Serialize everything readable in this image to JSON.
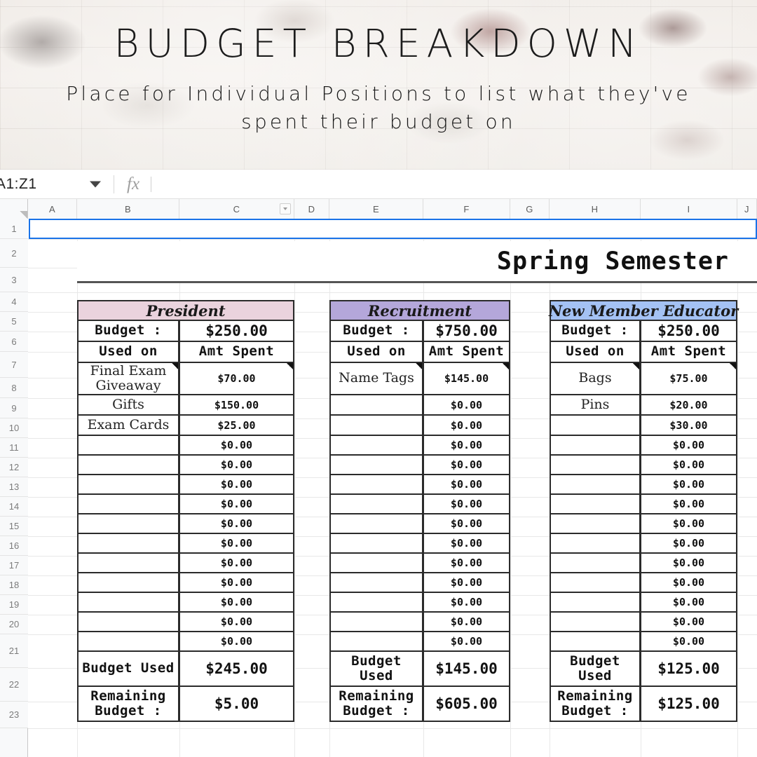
{
  "banner": {
    "title": "BUDGET BREAKDOWN",
    "subtitle": "Place for Individual Positions to list what they've spent their budget on"
  },
  "formula_bar": {
    "name_box_value": "A1:Z1",
    "name_box_dropdown_icon": "chevron-down-icon",
    "fx_icon": "fx-icon",
    "formula_value": "",
    "formula_placeholder": ""
  },
  "grid": {
    "column_headers": [
      "A",
      "B",
      "C",
      "D",
      "E",
      "F",
      "G",
      "H",
      "I",
      "J"
    ],
    "column_dropdown_on": "C",
    "row_headers": [
      "1",
      "2",
      "3",
      "4",
      "5",
      "6",
      "7",
      "8",
      "9",
      "10",
      "11",
      "12",
      "13",
      "14",
      "15",
      "16",
      "17",
      "18",
      "19",
      "20",
      "21",
      "22",
      "23"
    ],
    "selected_range": "A1:Z1"
  },
  "sheet": {
    "semester_title": "Spring Semester",
    "column_header_labels": {
      "used_on": "Used on",
      "amt_spent": "Amt Spent",
      "budget_label": "Budget :",
      "budget_used_label": "Budget Used",
      "remaining_label": "Remaining Budget :"
    },
    "tables": [
      {
        "name": "President",
        "header_color": "#ead3dd",
        "budget_label": "Budget :",
        "budget": "$250.00",
        "col_used_on": "Used on",
        "col_amt_spent": "Amt Spent",
        "items": [
          {
            "used_on": "Final Exam Giveaway",
            "amount": "$70.00",
            "note": true
          },
          {
            "used_on": "Gifts",
            "amount": "$150.00",
            "note": false
          },
          {
            "used_on": "Exam Cards",
            "amount": "$25.00",
            "note": false
          },
          {
            "used_on": "",
            "amount": "$0.00",
            "note": false
          },
          {
            "used_on": "",
            "amount": "$0.00",
            "note": false
          },
          {
            "used_on": "",
            "amount": "$0.00",
            "note": false
          },
          {
            "used_on": "",
            "amount": "$0.00",
            "note": false
          },
          {
            "used_on": "",
            "amount": "$0.00",
            "note": false
          },
          {
            "used_on": "",
            "amount": "$0.00",
            "note": false
          },
          {
            "used_on": "",
            "amount": "$0.00",
            "note": false
          },
          {
            "used_on": "",
            "amount": "$0.00",
            "note": false
          },
          {
            "used_on": "",
            "amount": "$0.00",
            "note": false
          },
          {
            "used_on": "",
            "amount": "$0.00",
            "note": false
          },
          {
            "used_on": "",
            "amount": "$0.00",
            "note": false
          }
        ],
        "budget_used_label": "Budget Used",
        "budget_used": "$245.00",
        "remaining_label": "Remaining Budget :",
        "remaining": "$5.00"
      },
      {
        "name": "Recruitment",
        "header_color": "#b4a7da",
        "budget_label": "Budget :",
        "budget": "$750.00",
        "col_used_on": "Used on",
        "col_amt_spent": "Amt Spent",
        "items": [
          {
            "used_on": "Name Tags",
            "amount": "$145.00",
            "note": true
          },
          {
            "used_on": "",
            "amount": "$0.00",
            "note": false
          },
          {
            "used_on": "",
            "amount": "$0.00",
            "note": false
          },
          {
            "used_on": "",
            "amount": "$0.00",
            "note": false
          },
          {
            "used_on": "",
            "amount": "$0.00",
            "note": false
          },
          {
            "used_on": "",
            "amount": "$0.00",
            "note": false
          },
          {
            "used_on": "",
            "amount": "$0.00",
            "note": false
          },
          {
            "used_on": "",
            "amount": "$0.00",
            "note": false
          },
          {
            "used_on": "",
            "amount": "$0.00",
            "note": false
          },
          {
            "used_on": "",
            "amount": "$0.00",
            "note": false
          },
          {
            "used_on": "",
            "amount": "$0.00",
            "note": false
          },
          {
            "used_on": "",
            "amount": "$0.00",
            "note": false
          },
          {
            "used_on": "",
            "amount": "$0.00",
            "note": false
          },
          {
            "used_on": "",
            "amount": "$0.00",
            "note": false
          }
        ],
        "budget_used_label": "Budget Used",
        "budget_used": "$145.00",
        "remaining_label": "Remaining Budget :",
        "remaining": "$605.00"
      },
      {
        "name": "New Member Educator",
        "header_color": "#a4c2f4",
        "budget_label": "Budget :",
        "budget": "$250.00",
        "col_used_on": "Used on",
        "col_amt_spent": "Amt Spent",
        "items": [
          {
            "used_on": "Bags",
            "amount": "$75.00",
            "note": true
          },
          {
            "used_on": "Pins",
            "amount": "$20.00",
            "note": false
          },
          {
            "used_on": "",
            "amount": "$30.00",
            "note": false
          },
          {
            "used_on": "",
            "amount": "$0.00",
            "note": false
          },
          {
            "used_on": "",
            "amount": "$0.00",
            "note": false
          },
          {
            "used_on": "",
            "amount": "$0.00",
            "note": false
          },
          {
            "used_on": "",
            "amount": "$0.00",
            "note": false
          },
          {
            "used_on": "",
            "amount": "$0.00",
            "note": false
          },
          {
            "used_on": "",
            "amount": "$0.00",
            "note": false
          },
          {
            "used_on": "",
            "amount": "$0.00",
            "note": false
          },
          {
            "used_on": "",
            "amount": "$0.00",
            "note": false
          },
          {
            "used_on": "",
            "amount": "$0.00",
            "note": false
          },
          {
            "used_on": "",
            "amount": "$0.00",
            "note": false
          },
          {
            "used_on": "",
            "amount": "$0.00",
            "note": false
          }
        ],
        "budget_used_label": "Budget Used",
        "budget_used": "$125.00",
        "remaining_label": "Remaining Budget :",
        "remaining": "$125.00"
      }
    ]
  },
  "colors": {
    "selection_blue": "#1a73e8",
    "grid_line": "#e8e8e8",
    "table_border": "#2b2b2b"
  }
}
